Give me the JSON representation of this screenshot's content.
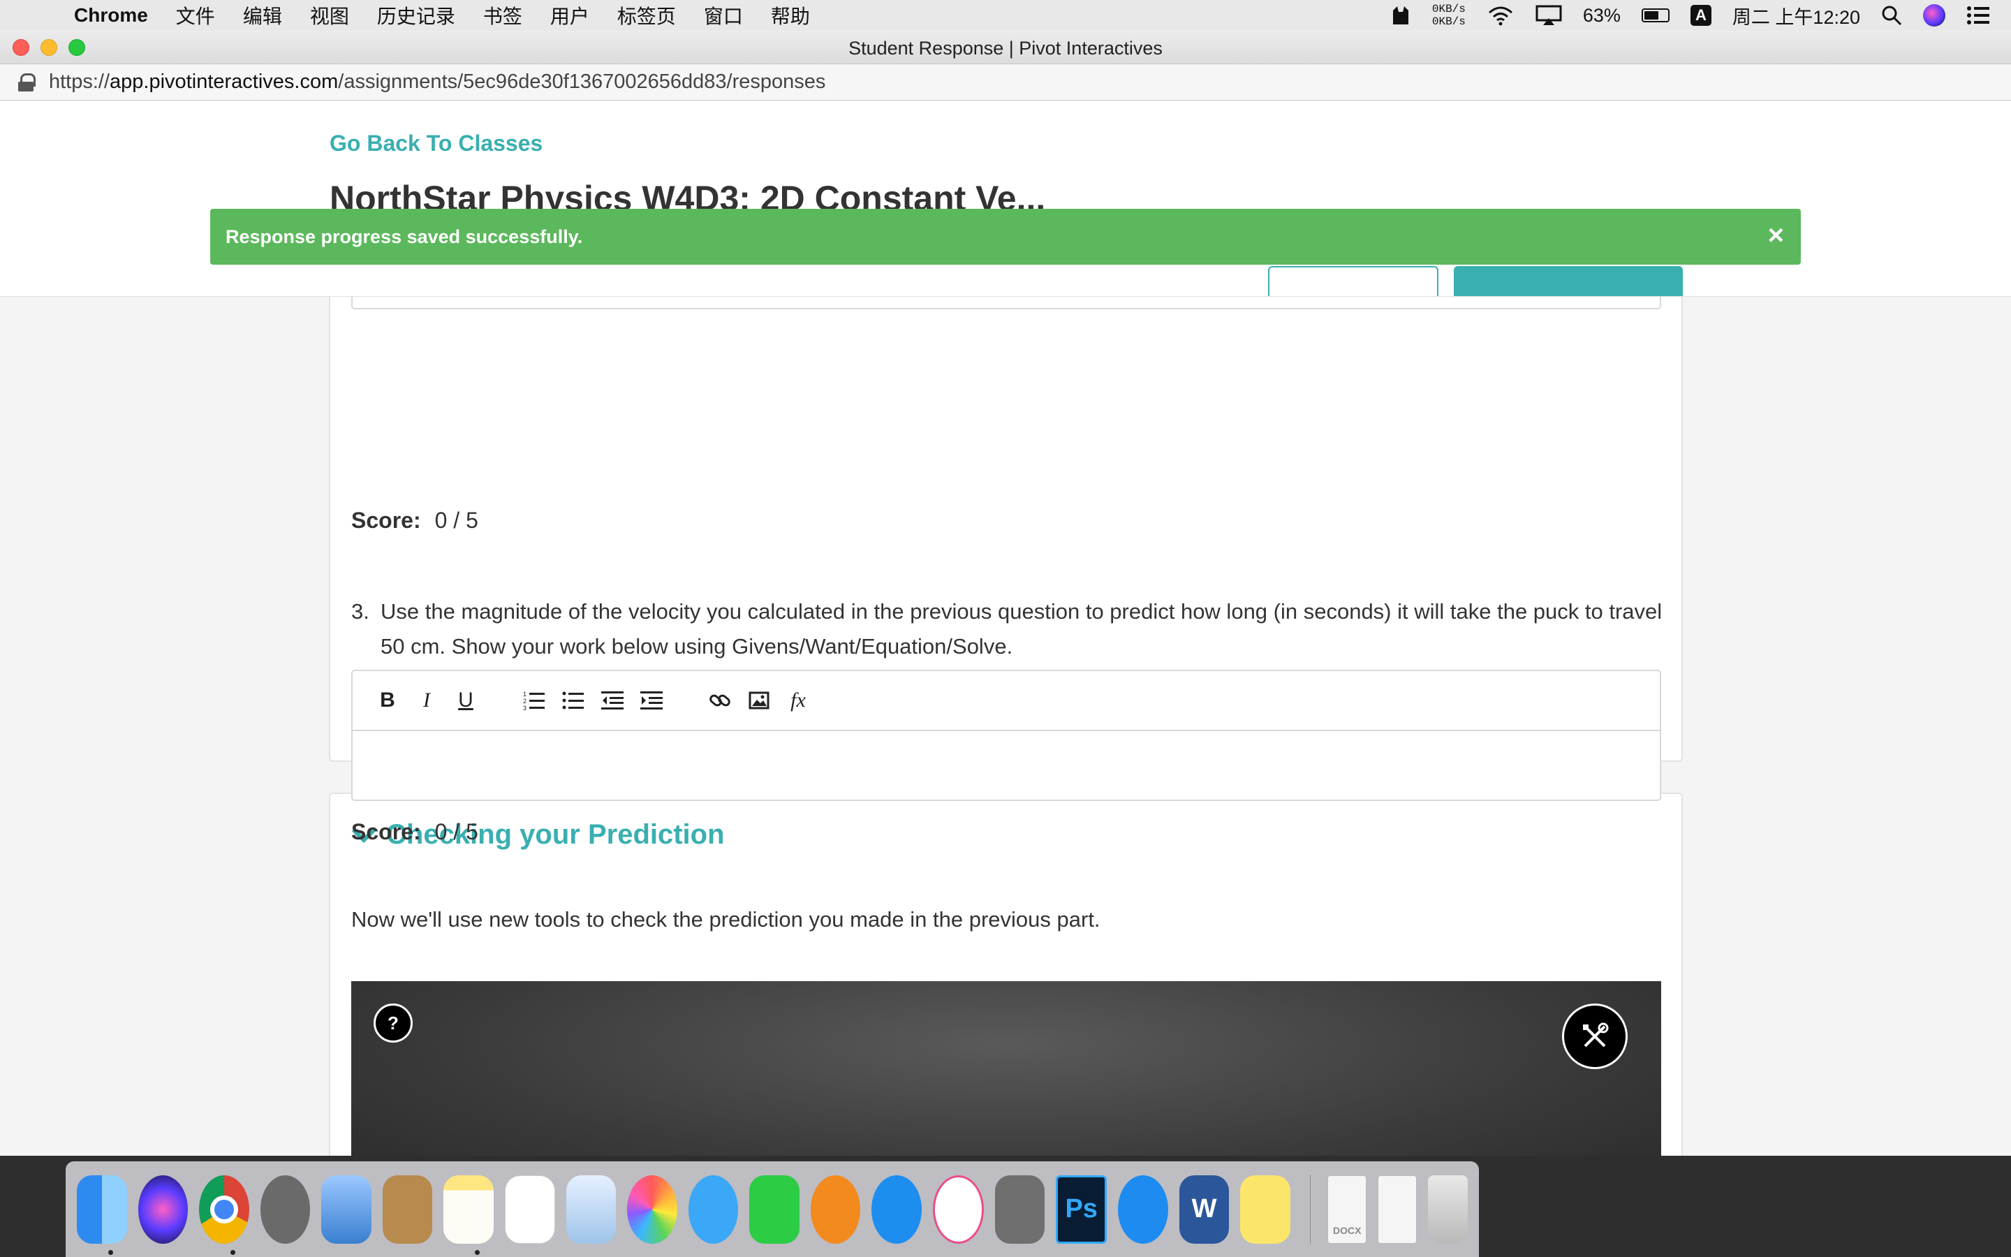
{
  "menubar": {
    "app_name": "Chrome",
    "menus": [
      "文件",
      "编辑",
      "视图",
      "历史记录",
      "书签",
      "用户",
      "标签页",
      "窗口",
      "帮助"
    ],
    "network_up": "0KB/s",
    "network_down": "0KB/s",
    "battery_percent": "63%",
    "battery_level": 0.63,
    "input_method": "A",
    "clock": "周二 上午12:20"
  },
  "window": {
    "title": "Student Response | Pivot Interactives",
    "url_scheme": "https://",
    "url_host": "app.pivotinteractives.com",
    "url_path": "/assignments/5ec96de30f1367002656dd83/responses"
  },
  "header": {
    "back_link": "Go Back To Classes",
    "assignment_title": "NorthStar Physics W4D3: 2D Constant Ve..."
  },
  "toast": {
    "message": "Response progress saved successfully.",
    "close": "×",
    "color": "#5cb85c"
  },
  "questions": {
    "score_label": "Score:",
    "q2_score": "0 / 5",
    "q3_number": "3.",
    "q3_text": "Use the magnitude of the velocity you calculated in the previous question to predict how long (in seconds) it will take the puck to travel 50 cm.  Show your work below using Givens/Want/Equation/Solve.",
    "q3_score": "0 / 5",
    "toolbar": {
      "bold": "B",
      "italic": "I",
      "underline": "U",
      "formula": "fx"
    }
  },
  "prediction": {
    "heading": "Checking your Prediction",
    "text": "Now we'll use new tools to check the prediction you made in the previous part.",
    "help": "?"
  },
  "colors": {
    "accent": "#3aafb0",
    "success": "#5cb85c"
  },
  "dock": {
    "apps": [
      "finder-icon",
      "siri-icon",
      "chrome-icon",
      "launchpad-icon",
      "mail-icon",
      "contacts-icon",
      "notes-icon",
      "reminders-icon",
      "preview-icon",
      "photos-icon",
      "messages-icon",
      "facetime-icon",
      "books-icon",
      "app-store-icon",
      "itunes-icon",
      "system-preferences-icon",
      "photoshop-icon",
      "safari-icon",
      "word-icon",
      "stickies-icon"
    ],
    "photoshop_label": "Ps",
    "word_label": "W",
    "docx_label": "DOCX"
  }
}
